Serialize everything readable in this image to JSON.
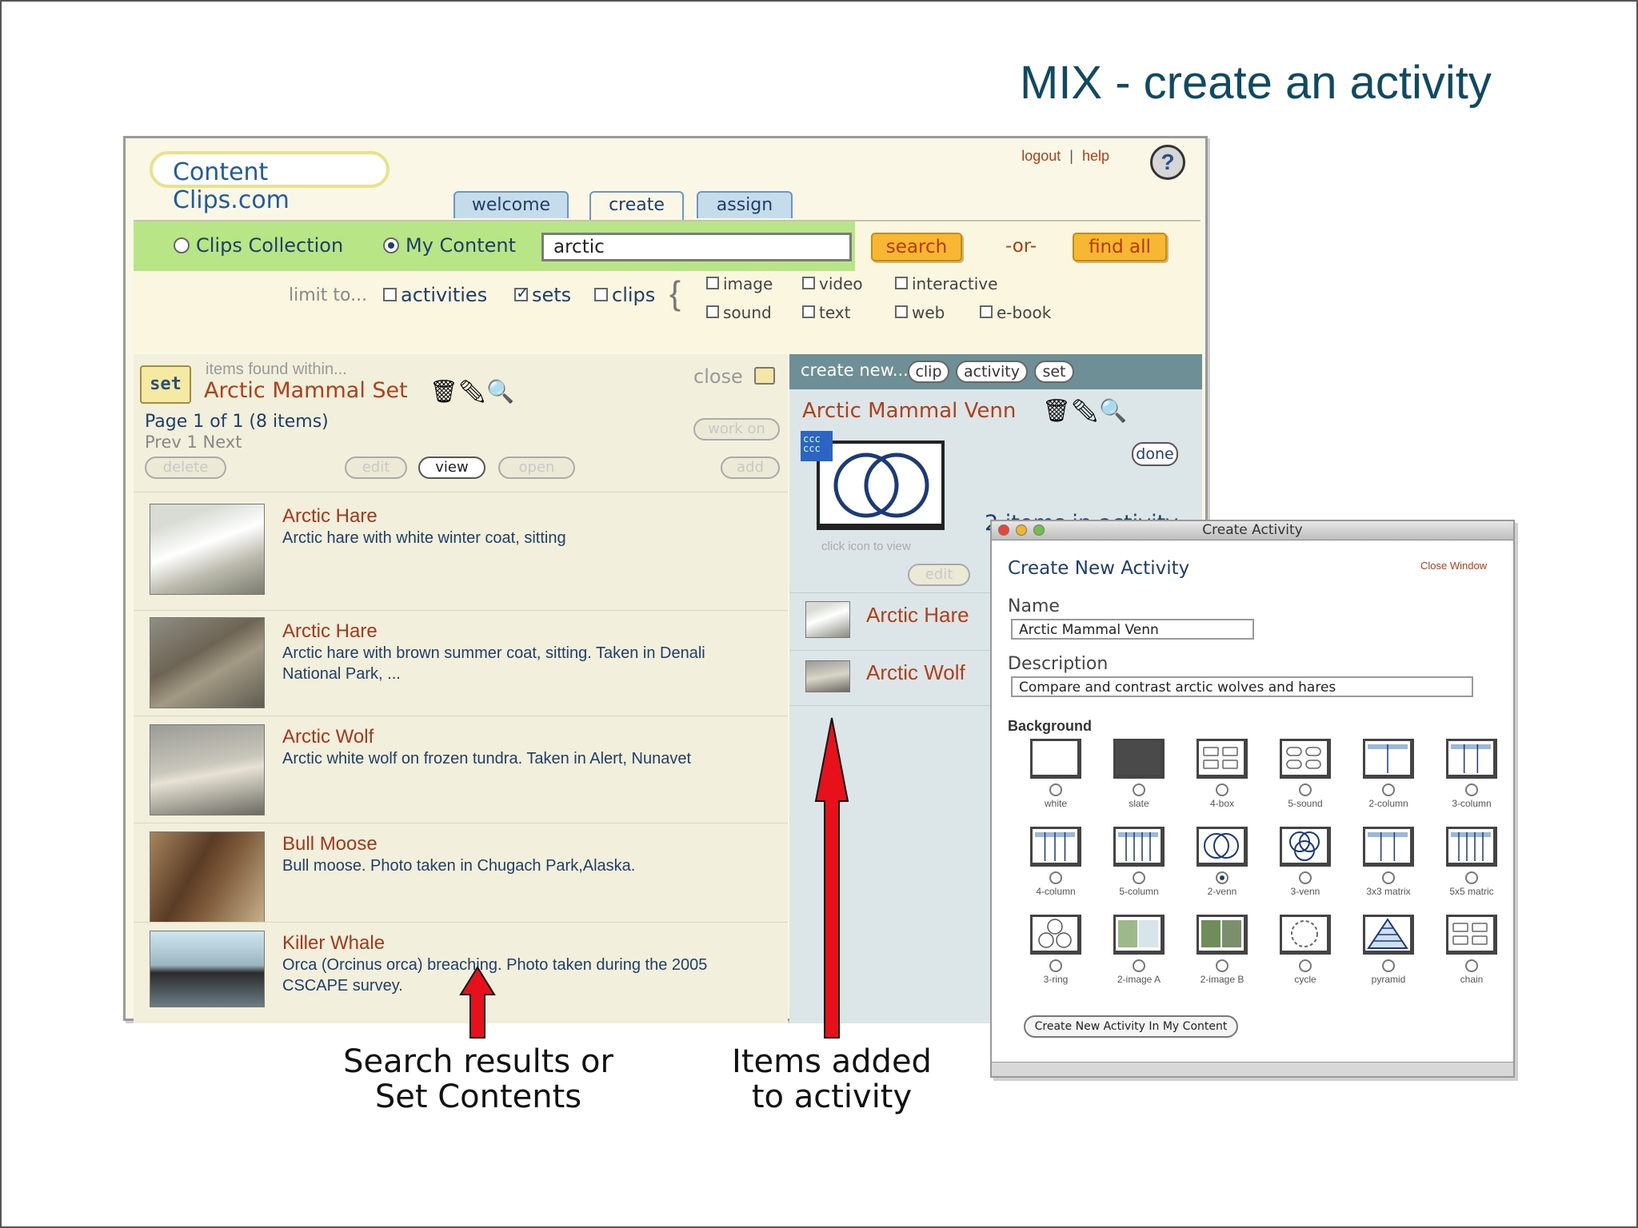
{
  "slide": {
    "title": "MIX - create an activity"
  },
  "app": {
    "logo": "Content Clips.com",
    "top_links": {
      "logout": "logout",
      "separator": "|",
      "help": "help"
    },
    "tabs": [
      {
        "label": "welcome"
      },
      {
        "label": "create",
        "active": true
      },
      {
        "label": "assign"
      }
    ],
    "search": {
      "scope_options": [
        {
          "label": "Clips Collection",
          "selected": false
        },
        {
          "label": "My Content",
          "selected": true
        }
      ],
      "query": "arctic",
      "search_label": "search",
      "or_label": "-or-",
      "find_all_label": "find all",
      "limit_label": "limit to...",
      "types": [
        {
          "label": "activities",
          "checked": false
        },
        {
          "label": "sets",
          "checked": true
        },
        {
          "label": "clips",
          "checked": false
        }
      ],
      "media": [
        {
          "label": "image",
          "checked": false
        },
        {
          "label": "video",
          "checked": false
        },
        {
          "label": "interactive",
          "checked": false
        },
        {
          "label": "sound",
          "checked": false
        },
        {
          "label": "text",
          "checked": false
        },
        {
          "label": "web",
          "checked": false
        },
        {
          "label": "e-book",
          "checked": false
        }
      ]
    },
    "left": {
      "set_icon_label": "set",
      "found_within": "items found within...",
      "set_title": "Arctic Mammal Set",
      "close_label": "close",
      "page_info": "Page 1 of 1  (8 items)",
      "pager": "Prev  1  Next",
      "work_on_label": "work on",
      "actions": {
        "delete": "delete",
        "edit": "edit",
        "view": "view",
        "open": "open",
        "add": "add"
      },
      "results": [
        {
          "title": "Arctic Hare",
          "description": "Arctic hare with white winter coat, sitting"
        },
        {
          "title": "Arctic Hare",
          "description": "Arctic hare with brown summer coat, sitting. Taken in Denali National Park, ..."
        },
        {
          "title": "Arctic Wolf",
          "description": "Arctic white wolf on frozen tundra. Taken in Alert, Nunavet"
        },
        {
          "title": "Bull Moose",
          "description": "Bull moose. Photo taken in Chugach Park,Alaska."
        },
        {
          "title": "Killer Whale",
          "description": "Orca (Orcinus orca) breaching. Photo taken during the 2005 CSCAPE survey."
        }
      ]
    },
    "right": {
      "create_new_label": "create new...",
      "create_buttons": {
        "clip": "clip",
        "activity": "activity",
        "set": "set"
      },
      "activity_title": "Arctic Mammal Venn",
      "done_label": "done",
      "icon_text": "ccc ccc",
      "click_icon_hint": "click icon to view",
      "items_count": "2 items in activity",
      "edit_label": "edit",
      "items": [
        {
          "name": "Arctic Hare"
        },
        {
          "name": "Arctic Wolf"
        }
      ]
    }
  },
  "dialog": {
    "window_title": "Create Activity",
    "heading": "Create New Activity",
    "close_window": "Close Window",
    "name_label": "Name",
    "name_value": "Arctic Mammal Venn",
    "description_label": "Description",
    "description_value": "Compare and contrast arctic wolves and hares",
    "background_label": "Background",
    "backgrounds": [
      {
        "name": "white",
        "icon": "white-icon",
        "selected": false
      },
      {
        "name": "slate",
        "icon": "slate-icon",
        "selected": false
      },
      {
        "name": "4-box",
        "icon": "4-box-icon",
        "selected": false
      },
      {
        "name": "5-sound",
        "icon": "5-sound-icon",
        "selected": false
      },
      {
        "name": "2-column",
        "icon": "2-column-icon",
        "selected": false
      },
      {
        "name": "3-column",
        "icon": "3-column-icon",
        "selected": false
      },
      {
        "name": "4-column",
        "icon": "4-column-icon",
        "selected": false
      },
      {
        "name": "5-column",
        "icon": "5-column-icon",
        "selected": false
      },
      {
        "name": "2-venn",
        "icon": "2-venn-icon",
        "selected": true
      },
      {
        "name": "3-venn",
        "icon": "3-venn-icon",
        "selected": false
      },
      {
        "name": "3x3 matrix",
        "icon": "3x3-matrix-icon",
        "selected": false
      },
      {
        "name": "5x5 matric",
        "icon": "5x5-matrix-icon",
        "selected": false
      },
      {
        "name": "3-ring",
        "icon": "3-ring-icon",
        "selected": false
      },
      {
        "name": "2-image A",
        "icon": "2-image-a-icon",
        "selected": false
      },
      {
        "name": "2-image B",
        "icon": "2-image-b-icon",
        "selected": false
      },
      {
        "name": "cycle",
        "icon": "cycle-icon",
        "selected": false
      },
      {
        "name": "pyramid",
        "icon": "pyramid-icon",
        "selected": false
      },
      {
        "name": "chain",
        "icon": "chain-icon",
        "selected": false
      }
    ],
    "create_button": "Create New Activity In My Content"
  },
  "annotations": {
    "left_caption": [
      "Search results or",
      "Set Contents"
    ],
    "right_caption": [
      "Items added",
      "to activity"
    ],
    "arrow_color": "#e8101a"
  },
  "colors": {
    "title": "#0f4a63",
    "link": "#b04018",
    "search_bar": "#b8e586",
    "orange_button": "#f7b733",
    "right_header": "#6d8f95"
  }
}
